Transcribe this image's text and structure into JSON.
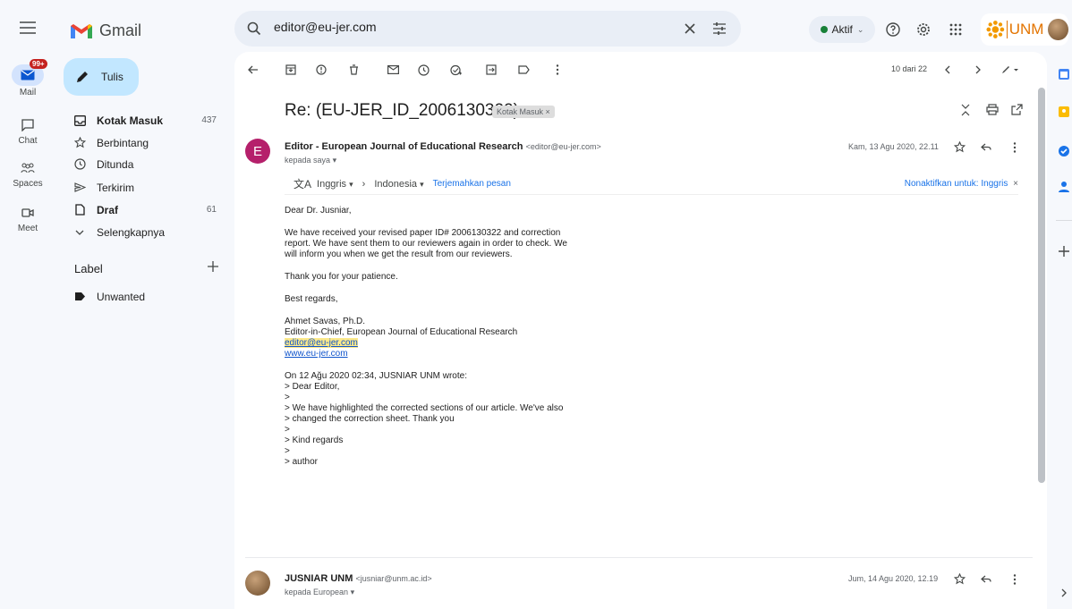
{
  "app": {
    "name": "Gmail"
  },
  "rail": {
    "badge": "99+",
    "items": [
      {
        "label": "Mail"
      },
      {
        "label": "Chat"
      },
      {
        "label": "Spaces"
      },
      {
        "label": "Meet"
      }
    ]
  },
  "search": {
    "value": "editor@eu-jer.com"
  },
  "header": {
    "status": "Aktif",
    "account_label": "UNM"
  },
  "sidebar": {
    "compose": "Tulis",
    "items": [
      {
        "label": "Kotak Masuk",
        "count": "437"
      },
      {
        "label": "Berbintang",
        "count": ""
      },
      {
        "label": "Ditunda",
        "count": ""
      },
      {
        "label": "Terkirim",
        "count": ""
      },
      {
        "label": "Draf",
        "count": "61"
      },
      {
        "label": "Selengkapnya",
        "count": ""
      }
    ],
    "labels_title": "Label",
    "labels": [
      {
        "label": "Unwanted"
      }
    ]
  },
  "toolbar": {
    "pagination": "10 dari 22"
  },
  "email": {
    "subject": "Re: (EU-JER_ID_2006130322)",
    "label_chip": "Kotak Masuk",
    "chip_close": "×",
    "sender_initial": "E",
    "sender_name": "Editor - European Journal of Educational Research",
    "sender_email": "<editor@eu-jer.com>",
    "recipient": "kepada saya",
    "date": "Kam, 13 Agu 2020, 22.11",
    "translate": {
      "from": "Inggris",
      "to": "Indonesia",
      "action": "Terjemahkan pesan",
      "disable": "Nonaktifkan untuk: Inggris"
    },
    "body": {
      "greeting": "Dear Dr. Jusniar,",
      "para1_l1": "We have received your revised paper ID# 2006130322 and correction",
      "para1_l2": "report. We have sent them to our reviewers again in order to check. We",
      "para1_l3": "will inform you when we get the result from our reviewers.",
      "thanks": "Thank you for your patience.",
      "regards": "Best regards,",
      "sig_name": "Ahmet Savas,  Ph.D.",
      "sig_title": "Editor-in-Chief, European Journal of Educational Research",
      "sig_email": "editor@eu-jer.com",
      "sig_web": "www.eu-jer.com",
      "quote_header": "On 12 Ağu 2020 02:34, JUSNIAR UNM wrote:",
      "quote": [
        "> Dear Editor,",
        ">",
        "> We have highlighted the corrected sections of our article. We've also",
        "> changed the correction sheet. Thank you",
        ">",
        "> Kind regards",
        ">",
        "> author"
      ]
    }
  },
  "reply": {
    "sender_name": "JUSNIAR UNM",
    "sender_email": "<jusniar@unm.ac.id>",
    "recipient": "kepada European",
    "date": "Jum, 14 Agu 2020, 12.19"
  },
  "colors": {
    "background": "#f6f8fc",
    "compose": "#c2e7ff",
    "avatar": "#b5206b",
    "link": "#1155cc",
    "highlight": "#fce98a",
    "status_dot": "#188038"
  }
}
